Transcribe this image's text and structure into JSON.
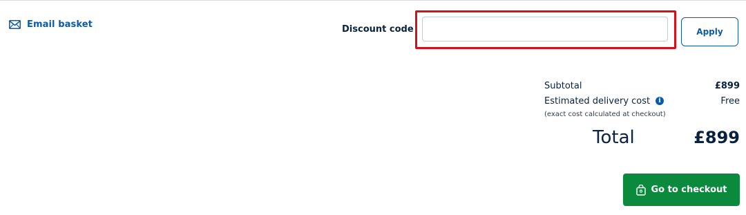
{
  "email_basket": {
    "label": "Email basket",
    "icon": "envelope-icon"
  },
  "discount": {
    "label": "Discount code",
    "input_value": "",
    "placeholder": "",
    "apply_label": "Apply"
  },
  "summary": {
    "subtotal_label": "Subtotal",
    "subtotal_value": "£899",
    "delivery_label": "Estimated delivery cost",
    "delivery_info_icon": "info-icon",
    "delivery_value": "Free",
    "note": "(exact cost calculated at checkout)",
    "total_label": "Total",
    "total_value": "£899"
  },
  "checkout": {
    "label": "Go to checkout",
    "icon": "shopping-bag-icon"
  },
  "colors": {
    "brand_blue": "#0b5ba8",
    "checkout_green": "#0b8a3e",
    "highlight_red": "#d5101a",
    "text_navy": "#0a2240"
  }
}
